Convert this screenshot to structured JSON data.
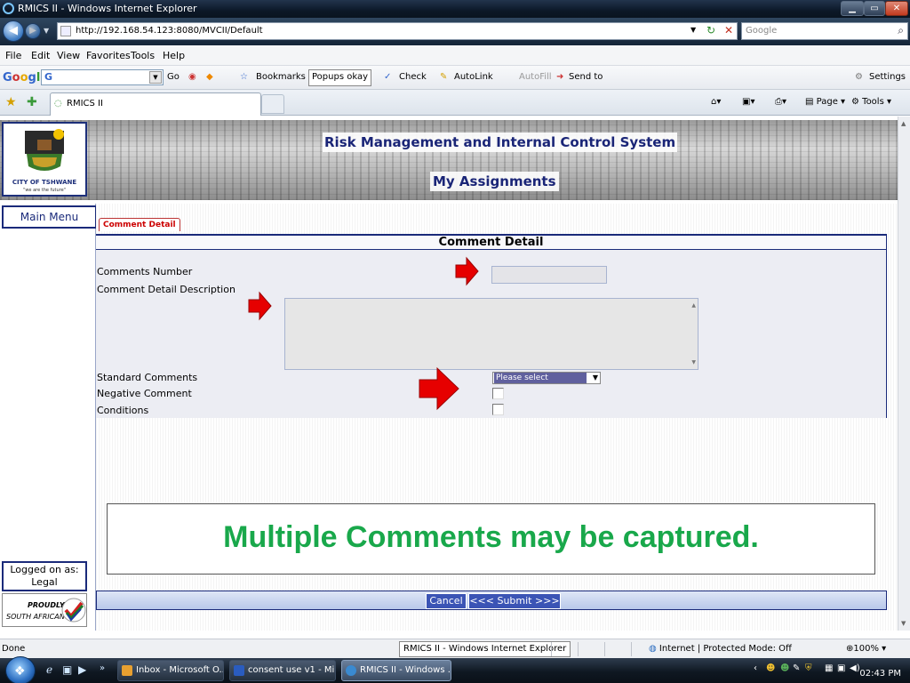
{
  "window": {
    "title": "RMICS II - Windows Internet Explorer"
  },
  "address": {
    "url": "http://192.168.54.123:8080/MVCII/Default",
    "search_placeholder": "Google"
  },
  "menu": [
    "File",
    "Edit",
    "View",
    "Favorites",
    "Tools",
    "Help"
  ],
  "google_toolbar": {
    "logo": "Google",
    "search_prefix": "G",
    "go": "Go",
    "bookmarks": "Bookmarks",
    "popups": "Popups okay",
    "check": "Check",
    "autolink": "AutoLink",
    "autofill": "AutoFill",
    "sendto": "Send to",
    "settings": "Settings"
  },
  "tab": {
    "label": "RMICS II"
  },
  "commandbar": {
    "page": "Page",
    "tools": "Tools"
  },
  "banner": {
    "system_title": "Risk Management and Internal Control System",
    "section_title": "My Assignments",
    "logo_city": "CITY OF TSHWANE",
    "logo_motto": "\"we are the future\""
  },
  "nav": {
    "main_menu": "Main Menu",
    "logged_on_label": "Logged on as:",
    "logged_on_user": "Legal",
    "proudly": "PROUDLY",
    "south_african": "SOUTH AFRICAN"
  },
  "form": {
    "tab_label": "Comment Detail",
    "heading": "Comment Detail",
    "fields": {
      "comments_number": "Comments Number",
      "description": "Comment Detail Description",
      "standard_comments": "Standard Comments",
      "negative_comment": "Negative Comment",
      "conditions": "Conditions"
    },
    "standard_select_value": "Please select",
    "negative_checked": false,
    "conditions_checked": false
  },
  "note": "Multiple Comments may be captured.",
  "buttons": {
    "cancel": "Cancel",
    "submit": "<<< Submit >>>"
  },
  "status": {
    "left": "Done",
    "tooltip": "RMICS II - Windows Internet Explorer",
    "zone": "Internet | Protected Mode: Off",
    "zoom": "100%"
  },
  "taskbar": {
    "tasks": [
      "Inbox - Microsoft O...",
      "consent use v1 - Mi...",
      "RMICS II - Windows ..."
    ],
    "clock": "02:43 PM"
  },
  "colors": {
    "accent": "#1a2a7a",
    "note_green": "#19a84b",
    "arrow_red": "#e60000"
  }
}
